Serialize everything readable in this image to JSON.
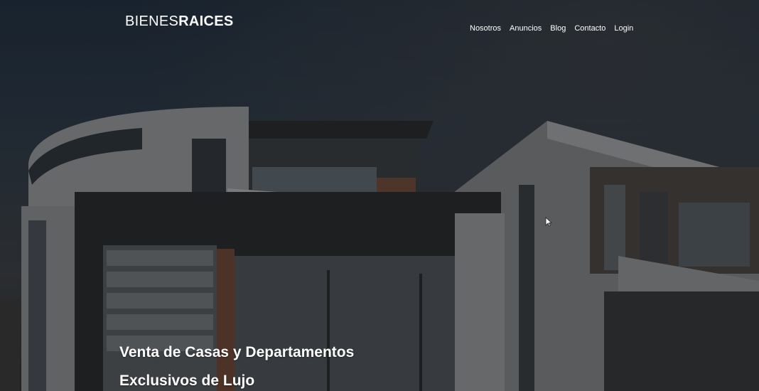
{
  "header": {
    "logo_thin": "BIENES",
    "logo_bold": "RAICES"
  },
  "nav": {
    "items": [
      {
        "label": "Nosotros"
      },
      {
        "label": "Anuncios"
      },
      {
        "label": "Blog"
      },
      {
        "label": "Contacto"
      },
      {
        "label": "Login"
      }
    ]
  },
  "hero": {
    "line1": "Venta de Casas y Departamentos",
    "line2": "Exclusivos de Lujo"
  },
  "colors": {
    "text": "#ffffff",
    "overlay": "#000000"
  }
}
